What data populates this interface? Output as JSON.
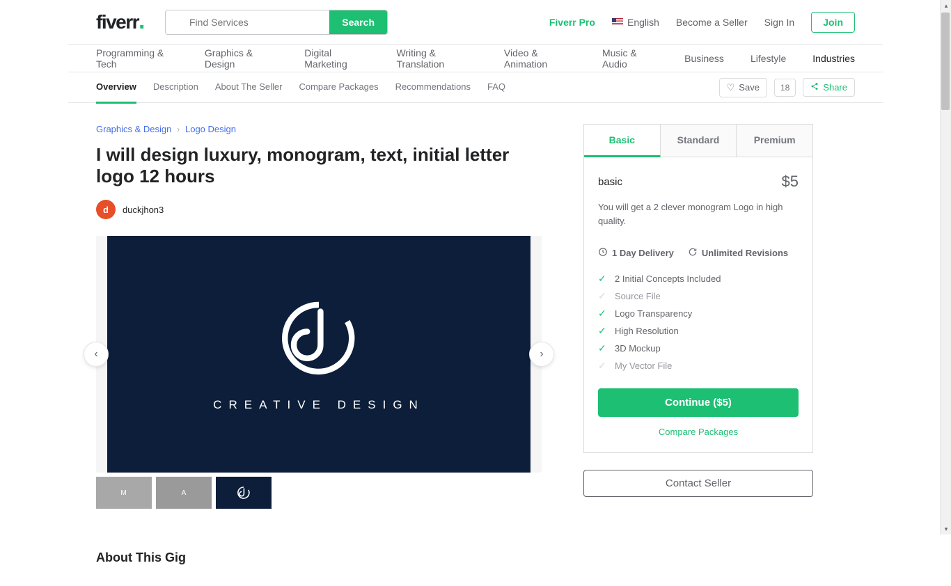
{
  "header": {
    "logo": "fiverr",
    "search_placeholder": "Find Services",
    "search_button": "Search",
    "fiverr_pro": "Fiverr Pro",
    "language": "English",
    "become_seller": "Become a Seller",
    "sign_in": "Sign In",
    "join": "Join"
  },
  "categories": [
    "Programming & Tech",
    "Graphics & Design",
    "Digital Marketing",
    "Writing & Translation",
    "Video & Animation",
    "Music & Audio",
    "Business",
    "Lifestyle",
    "Industries"
  ],
  "subnav": {
    "items": [
      "Overview",
      "Description",
      "About The Seller",
      "Compare Packages",
      "Recommendations",
      "FAQ"
    ],
    "save": "Save",
    "save_count": "18",
    "share": "Share"
  },
  "breadcrumb": {
    "cat": "Graphics & Design",
    "sub": "Logo Design"
  },
  "gig": {
    "title": "I will design luxury, monogram, text, initial letter logo 12 hours",
    "seller": "duckjhon3",
    "avatar_letter": "d",
    "slide_text": "CREATIVE DESIGN"
  },
  "package": {
    "tabs": [
      "Basic",
      "Standard",
      "Premium"
    ],
    "name": "basic",
    "price": "$5",
    "desc": "You will get a 2 clever monogram Logo in high quality.",
    "delivery": "1 Day Delivery",
    "revisions": "Unlimited Revisions",
    "features": [
      {
        "label": "2 Initial Concepts Included",
        "included": true
      },
      {
        "label": "Source File",
        "included": false
      },
      {
        "label": "Logo Transparency",
        "included": true
      },
      {
        "label": "High Resolution",
        "included": true
      },
      {
        "label": "3D Mockup",
        "included": true
      },
      {
        "label": "My Vector File",
        "included": false
      }
    ],
    "continue": "Continue ($5)",
    "compare": "Compare Packages",
    "contact": "Contact Seller"
  },
  "about_heading": "About This Gig"
}
